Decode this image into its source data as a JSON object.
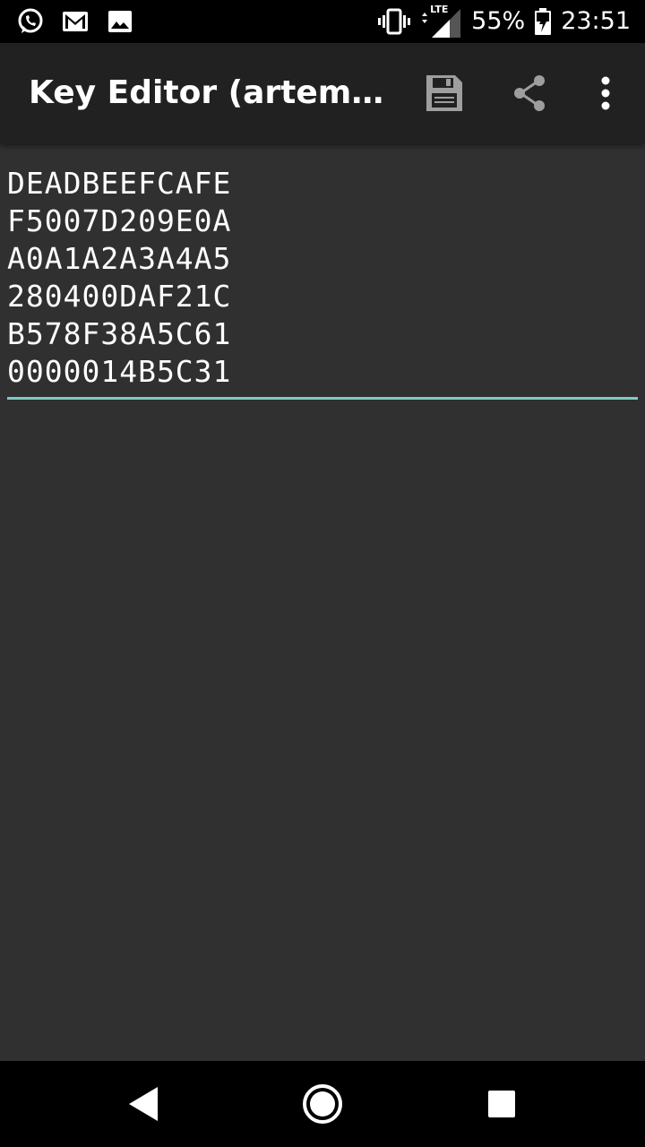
{
  "status_bar": {
    "notification_icons": [
      "whatsapp-icon",
      "gmail-icon",
      "image-icon"
    ],
    "system_icons": [
      "vibrate-icon",
      "lte-signal-icon",
      "battery-charging-icon"
    ],
    "network_label": "LTE",
    "battery": "55%",
    "time": "23:51"
  },
  "app_bar": {
    "title": "Key Editor (artem.ke…",
    "actions": [
      {
        "name": "save",
        "icon": "save-icon"
      },
      {
        "name": "share",
        "icon": "share-icon"
      },
      {
        "name": "more",
        "icon": "more-vert-icon"
      }
    ]
  },
  "editor": {
    "lines": [
      "DEADBEEFCAFE",
      "F5007D209E0A",
      "A0A1A2A3A4A5",
      "280400DAF21C",
      "B578F38A5C61",
      "0000014B5C31"
    ],
    "underline_color": "#80cbc4"
  },
  "nav_bar": {
    "buttons": [
      "back-icon",
      "home-icon",
      "recents-icon"
    ]
  },
  "colors": {
    "status_bar": "#000000",
    "app_bar": "#212121",
    "background": "#303030",
    "text": "#ffffff",
    "accent": "#80cbc4"
  }
}
